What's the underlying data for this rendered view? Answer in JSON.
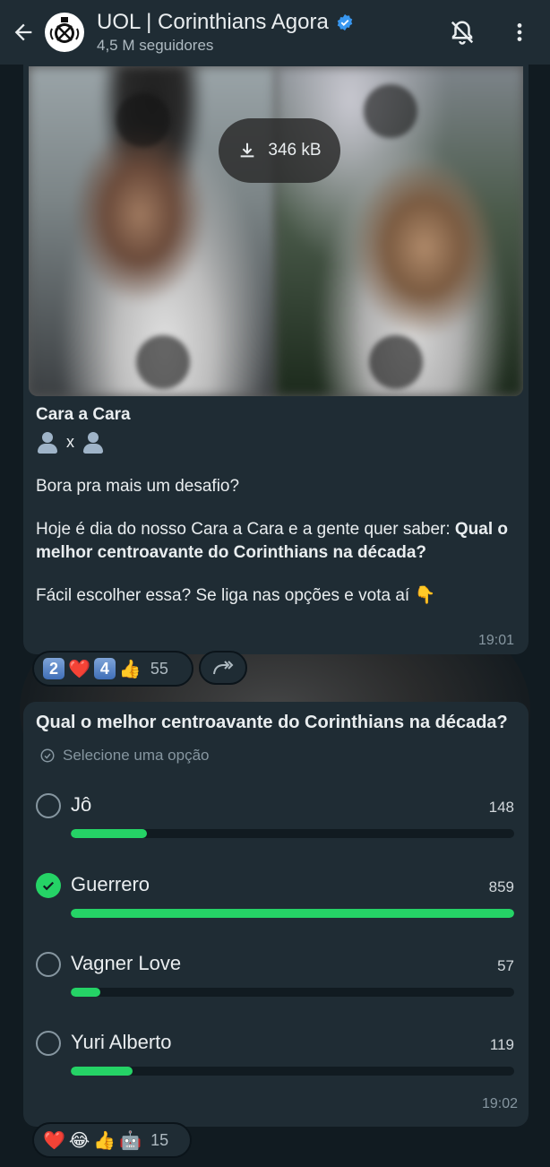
{
  "header": {
    "title": "UOL | Corinthians Agora",
    "subtitle": "4,5 M seguidores",
    "icons": [
      "back-arrow-icon",
      "corinthians-logo",
      "verified-badge-icon",
      "mute-bell-icon",
      "more-vert-icon"
    ]
  },
  "message1": {
    "download_size": "346 kB",
    "title": "Cara a Cara",
    "versus": "x",
    "line1": "Bora pra mais um desafio?",
    "line2_prefix": "Hoje é dia do nosso Cara a Cara e a gente quer saber: ",
    "line2_bold": "Qual o melhor centroavante do Corinthians na década?",
    "line3": "Fácil escolher essa? Se liga nas opções e vota aí 👇",
    "time": "19:01",
    "reactions": {
      "items": [
        "2",
        "❤️",
        "4",
        "👍"
      ],
      "count": "55"
    }
  },
  "poll": {
    "question": "Qual o melhor centroavante do Corinthians na década?",
    "hint": "Selecione uma opção",
    "total_max": 859,
    "options": [
      {
        "label": "Jô",
        "count": "148",
        "value": 148,
        "selected": false
      },
      {
        "label": "Guerrero",
        "count": "859",
        "value": 859,
        "selected": true
      },
      {
        "label": "Vagner Love",
        "count": "57",
        "value": 57,
        "selected": false
      },
      {
        "label": "Yuri Alberto",
        "count": "119",
        "value": 119,
        "selected": false
      }
    ],
    "time": "19:02",
    "reactions": {
      "items": [
        "❤️",
        "😂",
        "👍",
        "🤖"
      ],
      "count": "15"
    }
  },
  "colors": {
    "accent": "#25d366",
    "bubble": "#1f2c34",
    "header": "#1f2c34",
    "background": "#0b141a",
    "verified": "#3897f0"
  }
}
